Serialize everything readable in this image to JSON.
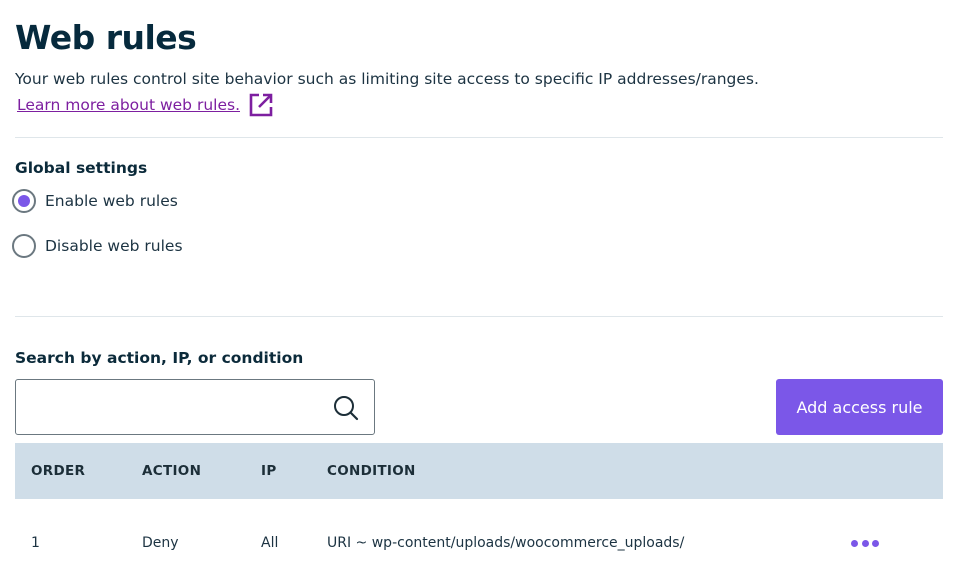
{
  "header": {
    "title": "Web rules",
    "description": "Your web rules control site behavior such as limiting site access to specific IP addresses/ranges.",
    "learn_more_link": "Learn more about web rules.",
    "learn_more_icon": "external-link-icon"
  },
  "global_settings": {
    "label": "Global settings",
    "options": [
      {
        "label": "Enable web rules",
        "checked": true
      },
      {
        "label": "Disable web rules",
        "checked": false
      }
    ]
  },
  "search": {
    "label": "Search by action, IP, or condition",
    "value": "",
    "placeholder": "",
    "icon": "search-icon"
  },
  "toolbar": {
    "add_button_label": "Add access rule"
  },
  "table": {
    "columns": [
      "ORDER",
      "ACTION",
      "IP",
      "CONDITION"
    ],
    "rows": [
      {
        "order": "1",
        "action": "Deny",
        "ip": "All",
        "condition": "URI ~ wp-content/uploads/woocommerce_uploads/",
        "menu_icon": "more-horizontal-icon"
      }
    ]
  },
  "colors": {
    "accent": "#7b57e8",
    "link": "#7d1fa0",
    "title": "#062a3d",
    "table_header_bg": "#cfdde8"
  }
}
